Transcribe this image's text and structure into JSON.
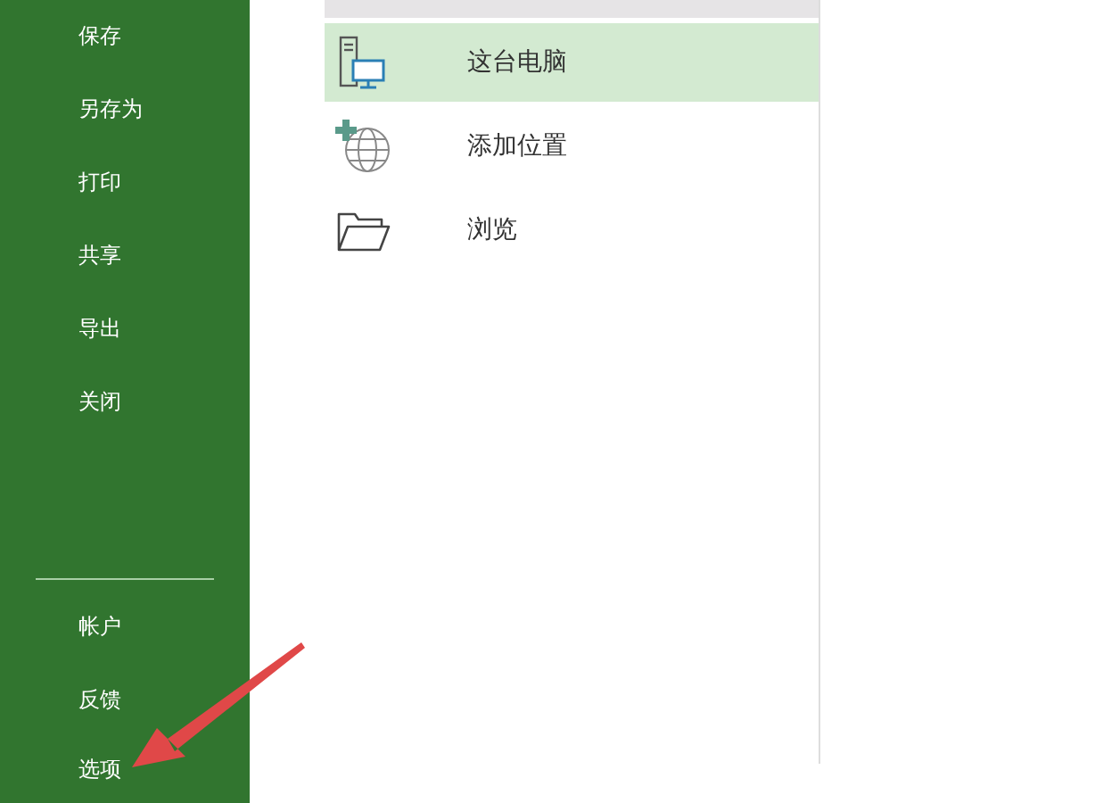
{
  "sidebar": {
    "items": [
      {
        "label": "保存"
      },
      {
        "label": "另存为"
      },
      {
        "label": "打印"
      },
      {
        "label": "共享"
      },
      {
        "label": "导出"
      },
      {
        "label": "关闭"
      }
    ],
    "bottom_items": [
      {
        "label": "帐户"
      },
      {
        "label": "反馈"
      },
      {
        "label": "选项"
      }
    ]
  },
  "places": [
    {
      "kind": "computer",
      "label": "这台电脑",
      "selected": true
    },
    {
      "kind": "add",
      "label": "添加位置",
      "selected": false
    },
    {
      "kind": "folder",
      "label": "浏览",
      "selected": false
    }
  ]
}
